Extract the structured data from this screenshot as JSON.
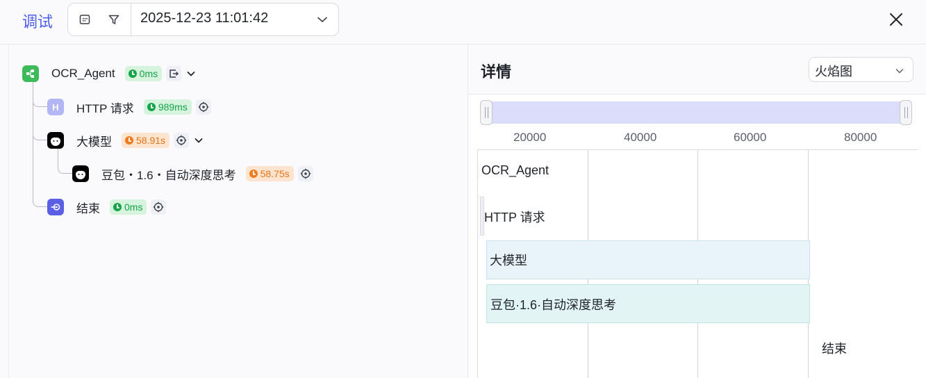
{
  "header": {
    "title": "调试",
    "datetime": "2025-12-23 11:01:42",
    "icons": [
      "calendar-icon",
      "filter-icon",
      "chevron-down-icon",
      "close-icon"
    ]
  },
  "tree": {
    "nodes": [
      {
        "label": "OCR_Agent",
        "duration": "0ms",
        "status": "green",
        "icon": "workflow-start-icon"
      },
      {
        "label": "HTTP 请求",
        "duration": "989ms",
        "status": "green",
        "icon": "http-icon",
        "icon_letter": "H"
      },
      {
        "label": "大模型",
        "duration": "58.91s",
        "status": "orange",
        "icon": "llm-face-icon"
      },
      {
        "label": "豆包・1.6・自动深度思考",
        "duration": "58.75s",
        "status": "orange",
        "icon": "model-face-icon"
      },
      {
        "label": "结束",
        "duration": "0ms",
        "status": "green",
        "icon": "end-icon"
      }
    ]
  },
  "detail": {
    "title": "详情",
    "view_select": "火焰图",
    "axis_ticks": [
      "20000",
      "40000",
      "60000",
      "80000"
    ],
    "flame_labels": [
      "OCR_Agent",
      "HTTP 请求",
      "大模型",
      "豆包·1.6·自动深度思考",
      "结束"
    ]
  },
  "colors": {
    "accent": "#4e5ef0",
    "green": "#16a34a",
    "orange": "#e8731b",
    "slider": "#dcdcfb"
  }
}
